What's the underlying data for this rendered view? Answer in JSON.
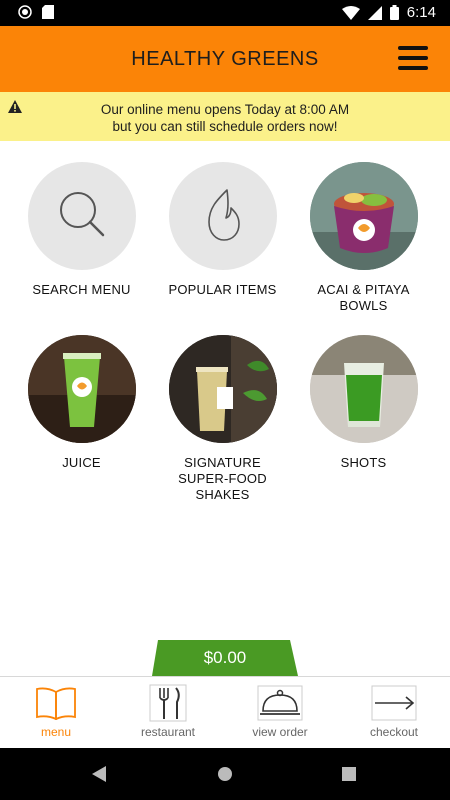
{
  "status_bar": {
    "time": "6:14"
  },
  "header": {
    "title": "HEALTHY GREENS"
  },
  "banner": {
    "line1": "Our online menu opens Today at 8:00 AM",
    "line2": "but you can still schedule orders now!"
  },
  "tiles": [
    {
      "label": "SEARCH MENU",
      "icon": "search-icon"
    },
    {
      "label": "POPULAR ITEMS",
      "icon": "flame-icon"
    },
    {
      "label_line1": "ACAI & PITAYA",
      "label_line2": "BOWLS",
      "icon": "acai-bowl-photo"
    },
    {
      "label": "JUICE",
      "icon": "juice-cup-photo"
    },
    {
      "label_line1": "SIGNATURE",
      "label_line2": "SUPER-FOOD",
      "label_line3": "SHAKES",
      "icon": "shake-photo"
    },
    {
      "label": "SHOTS",
      "icon": "shot-glass-photo"
    }
  ],
  "cart": {
    "total": "$0.00"
  },
  "bottom_nav": {
    "items": [
      {
        "label": "menu",
        "icon": "book-icon",
        "active": true
      },
      {
        "label": "restaurant",
        "icon": "fork-knife-icon",
        "active": false
      },
      {
        "label": "view order",
        "icon": "cloche-icon",
        "active": false
      },
      {
        "label": "checkout",
        "icon": "arrow-right-icon",
        "active": false
      }
    ]
  },
  "colors": {
    "header_bg": "#fb8407",
    "banner_bg": "#fbf18a",
    "cart_tab_bg": "#4a9a24",
    "active_nav": "#fb8407"
  }
}
